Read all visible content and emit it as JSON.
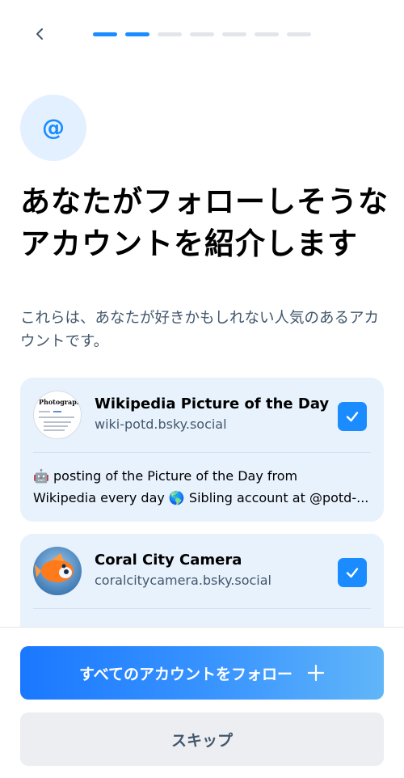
{
  "header": {
    "back_icon": "chevron-left-icon",
    "progress": {
      "total_steps": 7,
      "completed_steps": 2,
      "active_color": "#1a8cff",
      "inactive_color": "#e2e6ea"
    }
  },
  "hero": {
    "icon_name": "at-sign-icon",
    "glyph": "@"
  },
  "title": "あなたがフォローしそうなアカウントを紹介します",
  "subtitle": "これらは、あなたが好きかもしれない人気のあるアカウントです。",
  "accounts": [
    {
      "name": "Wikipedia Picture of the Day",
      "handle": "wiki-potd.bsky.social",
      "avatar_text": "Photograph",
      "selected": true,
      "description_lines": [
        "🤖 posting of the Picture of the Day from",
        "Wikipedia every day 🌎 Sibling account at @potd-..."
      ]
    },
    {
      "name": "Coral City Camera",
      "handle": "coralcitycamera.bsky.social",
      "selected": true,
      "description_lines": []
    }
  ],
  "actions": {
    "follow_all_label": "すべてのアカウントをフォロー",
    "follow_all_icon": "plus-icon",
    "skip_label": "スキップ"
  },
  "colors": {
    "accent": "#1a8cff",
    "card_bg": "#e8f2fd",
    "muted_text": "#42576c"
  }
}
